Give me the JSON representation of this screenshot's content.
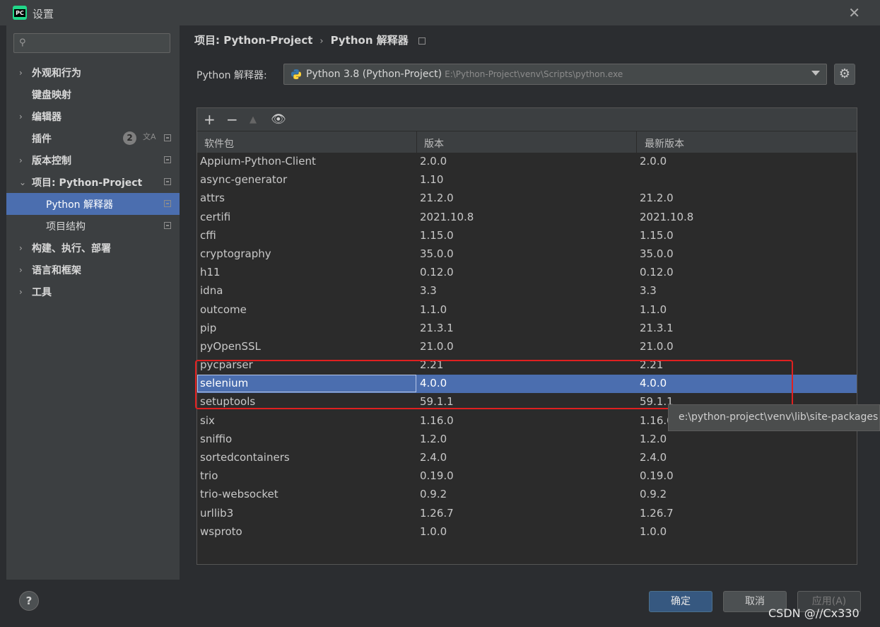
{
  "window": {
    "title": "设置",
    "app_icon_text": "PC"
  },
  "sidebar": {
    "search_placeholder": "",
    "items": [
      {
        "label": "外观和行为",
        "chevron": "›",
        "child": false,
        "box": false
      },
      {
        "label": "键盘映射",
        "chevron": "",
        "child": false,
        "box": false
      },
      {
        "label": "编辑器",
        "chevron": "›",
        "child": false,
        "box": false
      },
      {
        "label": "插件",
        "chevron": "",
        "child": false,
        "box": true,
        "badge": "2"
      },
      {
        "label": "版本控制",
        "chevron": "›",
        "child": false,
        "box": true
      },
      {
        "label": "项目: Python-Project",
        "chevron": "⌄",
        "child": false,
        "box": true
      },
      {
        "label": "Python 解释器",
        "chevron": "",
        "child": true,
        "box": true,
        "selected": true
      },
      {
        "label": "项目结构",
        "chevron": "",
        "child": true,
        "box": true
      },
      {
        "label": "构建、执行、部署",
        "chevron": "›",
        "child": false,
        "box": false
      },
      {
        "label": "语言和框架",
        "chevron": "›",
        "child": false,
        "box": false
      },
      {
        "label": "工具",
        "chevron": "›",
        "child": false,
        "box": false
      }
    ]
  },
  "breadcrumb": {
    "project": "项目: Python-Project",
    "separator": "›",
    "page": "Python 解释器"
  },
  "interpreter": {
    "label": "Python 解释器:",
    "name": "Python 3.8 (Python-Project)",
    "path": "E:\\Python-Project\\venv\\Scripts\\python.exe"
  },
  "table": {
    "columns": [
      "软件包",
      "版本",
      "最新版本"
    ],
    "rows": [
      [
        "Appium-Python-Client",
        "2.0.0",
        "2.0.0"
      ],
      [
        "async-generator",
        "1.10",
        ""
      ],
      [
        "attrs",
        "21.2.0",
        "21.2.0"
      ],
      [
        "certifi",
        "2021.10.8",
        "2021.10.8"
      ],
      [
        "cffi",
        "1.15.0",
        "1.15.0"
      ],
      [
        "cryptography",
        "35.0.0",
        "35.0.0"
      ],
      [
        "h11",
        "0.12.0",
        "0.12.0"
      ],
      [
        "idna",
        "3.3",
        "3.3"
      ],
      [
        "outcome",
        "1.1.0",
        "1.1.0"
      ],
      [
        "pip",
        "21.3.1",
        "21.3.1"
      ],
      [
        "pyOpenSSL",
        "21.0.0",
        "21.0.0"
      ],
      [
        "pycparser",
        "2.21",
        "2.21"
      ],
      [
        "selenium",
        "4.0.0",
        "4.0.0"
      ],
      [
        "setuptools",
        "59.1.1",
        "59.1.1"
      ],
      [
        "six",
        "1.16.0",
        "1.16.0"
      ],
      [
        "sniffio",
        "1.2.0",
        "1.2.0"
      ],
      [
        "sortedcontainers",
        "2.4.0",
        "2.4.0"
      ],
      [
        "trio",
        "0.19.0",
        "0.19.0"
      ],
      [
        "trio-websocket",
        "0.9.2",
        "0.9.2"
      ],
      [
        "urllib3",
        "1.26.7",
        "1.26.7"
      ],
      [
        "wsproto",
        "1.0.0",
        "1.0.0"
      ]
    ],
    "selected_row": 12
  },
  "tooltip": {
    "text": "e:\\python-project\\venv\\lib\\site-packages"
  },
  "buttons": {
    "ok": "确定",
    "cancel": "取消",
    "apply": "应用(A)",
    "help": "?"
  },
  "watermark": "CSDN @//Cx330",
  "colors": {
    "selection": "#4b6eaf",
    "highlight_box": "#e02020",
    "ok_button": "#365880"
  }
}
